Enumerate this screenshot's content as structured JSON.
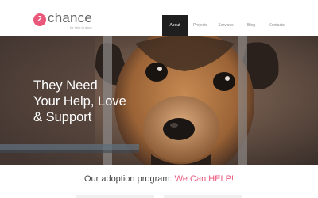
{
  "brand": {
    "badge": "2",
    "name": "chance",
    "tagline": "for help to dogs",
    "accent_color": "#e9577a"
  },
  "nav": {
    "items": [
      {
        "label": "About",
        "active": true
      },
      {
        "label": "Projects",
        "active": false
      },
      {
        "label": "Services",
        "active": false
      },
      {
        "label": "Blog",
        "active": false
      },
      {
        "label": "Contacts",
        "active": false
      }
    ]
  },
  "hero": {
    "lines": [
      "They Need",
      "Your Help, Love",
      "& Support"
    ],
    "image": "puppy-behind-fence-photo"
  },
  "adoption": {
    "prefix": "Our adoption program:",
    "highlight": "We Can HELP!"
  }
}
